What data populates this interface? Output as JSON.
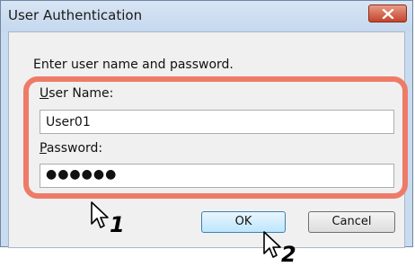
{
  "dialog": {
    "title": "User Authentication",
    "prompt": "Enter user name and password.",
    "username_label_accel": "U",
    "username_label_rest": "ser Name:",
    "username_value": "User01",
    "password_label_accel": "P",
    "password_label_rest": "assword:",
    "password_value": "●●●●●●",
    "ok_label": "OK",
    "cancel_label": "Cancel"
  },
  "callouts": {
    "step1": "1",
    "step2": "2"
  },
  "colors": {
    "highlight": "#ee7b67",
    "close_button": "#c4442c"
  }
}
